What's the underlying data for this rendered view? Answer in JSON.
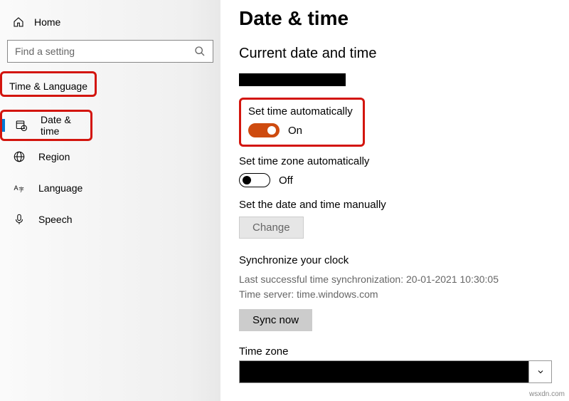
{
  "sidebar": {
    "home": "Home",
    "search_placeholder": "Find a setting",
    "section_title": "Time & Language",
    "items": [
      {
        "label": "Date & time"
      },
      {
        "label": "Region"
      },
      {
        "label": "Language"
      },
      {
        "label": "Speech"
      }
    ]
  },
  "main": {
    "title": "Date & time",
    "subtitle": "Current date and time",
    "set_time_auto": {
      "label": "Set time automatically",
      "state": "On"
    },
    "set_tz_auto": {
      "label": "Set time zone automatically",
      "state": "Off"
    },
    "manual": {
      "label": "Set the date and time manually",
      "button": "Change"
    },
    "sync": {
      "heading": "Synchronize your clock",
      "last_line": "Last successful time synchronization: 20-01-2021 10:30:05",
      "server_line": "Time server: time.windows.com",
      "button": "Sync now"
    },
    "timezone_label": "Time zone"
  },
  "watermark": "wsxdn.com"
}
